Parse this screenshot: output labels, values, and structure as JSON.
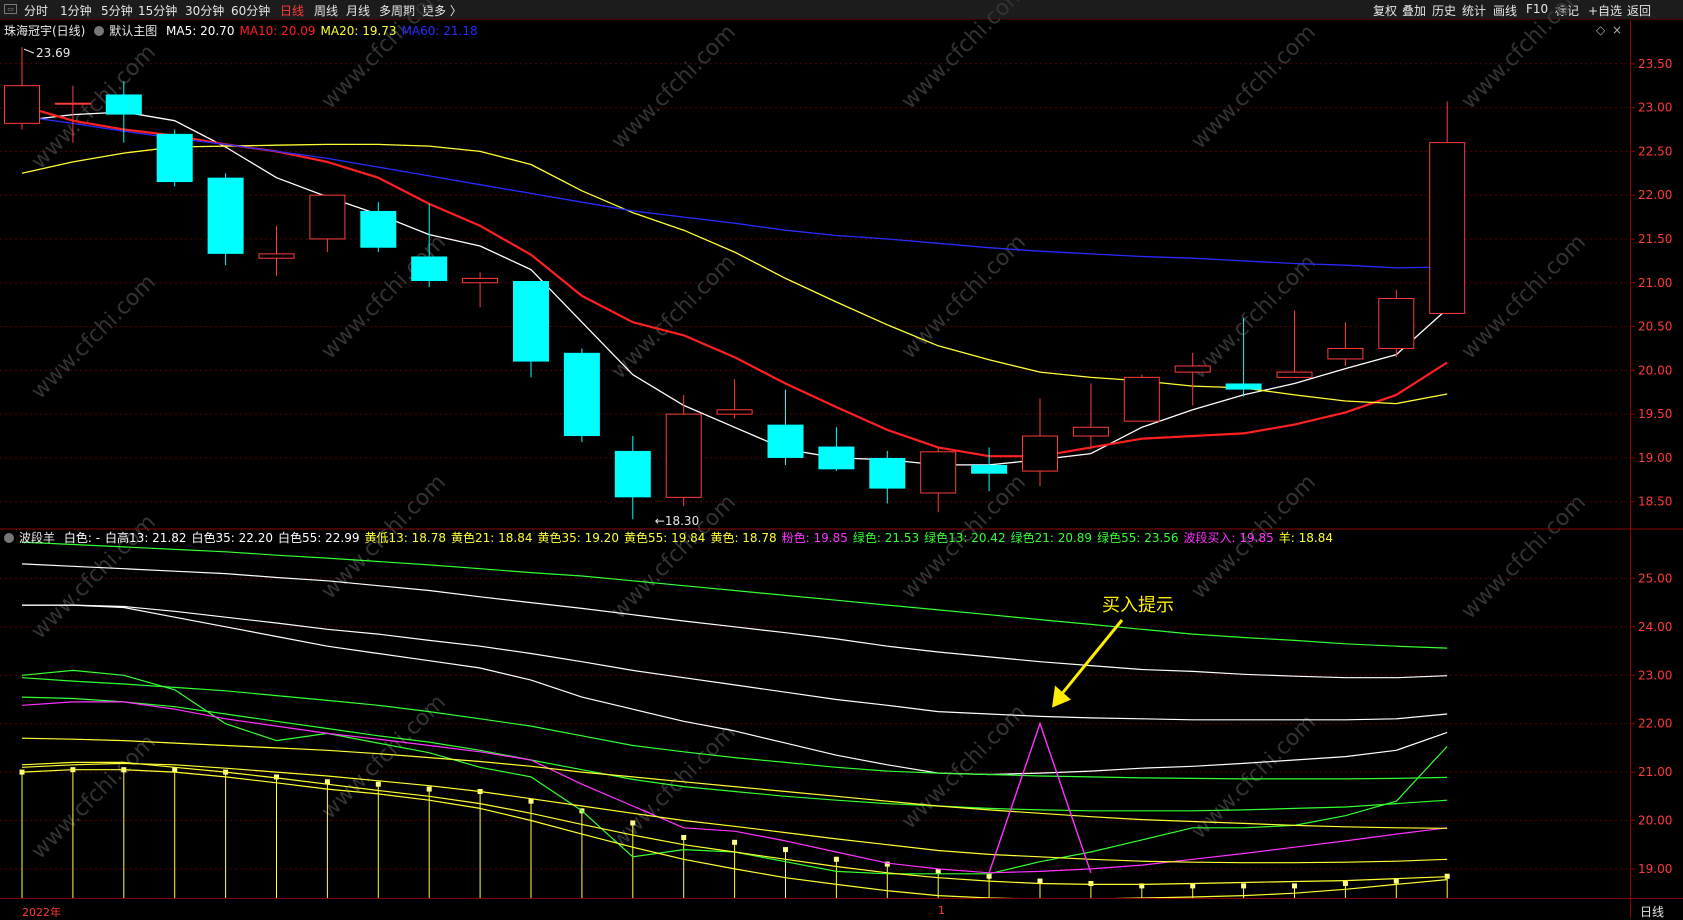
{
  "toolbar": {
    "left": [
      "分时",
      "1分钟",
      "5分钟",
      "15分钟",
      "30分钟",
      "60分钟",
      "日线",
      "周线",
      "月线",
      "多周期",
      "更多 〉"
    ],
    "active": "日线",
    "right": [
      "复权",
      "叠加",
      "历史",
      "统计",
      "画线",
      "F10",
      "标记",
      "+自选",
      "返回"
    ]
  },
  "main_legend": {
    "stock": "珠海冠宇(日线)",
    "indicator": "默认主图",
    "items": [
      {
        "label": "MA5: 20.70",
        "color": "#ffffff"
      },
      {
        "label": "MA10: 20.09",
        "color": "#ff2020"
      },
      {
        "label": "MA20: 19.73",
        "color": "#ffff33"
      },
      {
        "label": "MA60: 21.18",
        "color": "#2a2aff"
      }
    ]
  },
  "sub_legend": {
    "name": "波段羊",
    "items": [
      {
        "label": "白色: -",
        "color": "#ffffff"
      },
      {
        "label": "白高13: 21.82",
        "color": "#ffffff"
      },
      {
        "label": "白色35: 22.20",
        "color": "#ffffff"
      },
      {
        "label": "白色55: 22.99",
        "color": "#ffffff"
      },
      {
        "label": "黄低13: 18.78",
        "color": "#ffff33"
      },
      {
        "label": "黄色21: 18.84",
        "color": "#ffff33"
      },
      {
        "label": "黄色35: 19.20",
        "color": "#ffff33"
      },
      {
        "label": "黄色55: 19.84",
        "color": "#ffff33"
      },
      {
        "label": "黄色: 18.78",
        "color": "#ffff33"
      },
      {
        "label": "粉色: 19.85",
        "color": "#ff33ff"
      },
      {
        "label": "绿色: 21.53",
        "color": "#33ff33"
      },
      {
        "label": "绿色13: 20.42",
        "color": "#33ff33"
      },
      {
        "label": "绿色21: 20.89",
        "color": "#33ff33"
      },
      {
        "label": "绿色55: 23.56",
        "color": "#33ff33"
      },
      {
        "label": "波段买入: 19.85",
        "color": "#ff33ff"
      },
      {
        "label": "羊: 18.84",
        "color": "#ffff33"
      }
    ]
  },
  "annotation": "买入提示",
  "bottom": {
    "year_label": "2022年",
    "month_label": "1",
    "period_button": "日线"
  },
  "watermark": "www.cfchi.com",
  "chart_data": [
    {
      "type": "candlestick",
      "panel": "main",
      "ylim": [
        18.2,
        24.0
      ],
      "y_ticks": [
        18.5,
        19.0,
        19.5,
        20.0,
        20.5,
        21.0,
        21.5,
        22.0,
        22.5,
        23.0,
        23.5
      ],
      "max_label": "23.69",
      "min_label": "18.30",
      "candles": [
        {
          "o": 22.82,
          "h": 23.69,
          "l": 22.75,
          "c": 23.25
        },
        {
          "o": 23.05,
          "h": 23.25,
          "l": 22.6,
          "c": 23.05
        },
        {
          "o": 23.15,
          "h": 23.3,
          "l": 22.6,
          "c": 22.92
        },
        {
          "o": 22.7,
          "h": 22.75,
          "l": 22.1,
          "c": 22.15
        },
        {
          "o": 22.2,
          "h": 22.25,
          "l": 21.2,
          "c": 21.33
        },
        {
          "o": 21.28,
          "h": 21.65,
          "l": 21.08,
          "c": 21.33
        },
        {
          "o": 21.5,
          "h": 22.0,
          "l": 21.35,
          "c": 22.0
        },
        {
          "o": 21.82,
          "h": 21.92,
          "l": 21.35,
          "c": 21.4
        },
        {
          "o": 21.3,
          "h": 21.9,
          "l": 20.95,
          "c": 21.02
        },
        {
          "o": 21.0,
          "h": 21.12,
          "l": 20.72,
          "c": 21.05
        },
        {
          "o": 21.02,
          "h": 21.02,
          "l": 19.92,
          "c": 20.1
        },
        {
          "o": 20.2,
          "h": 20.25,
          "l": 19.18,
          "c": 19.25
        },
        {
          "o": 19.08,
          "h": 19.25,
          "l": 18.3,
          "c": 18.55
        },
        {
          "o": 18.55,
          "h": 19.72,
          "l": 18.45,
          "c": 19.5
        },
        {
          "o": 19.5,
          "h": 19.9,
          "l": 19.45,
          "c": 19.55
        },
        {
          "o": 19.38,
          "h": 19.78,
          "l": 18.92,
          "c": 19.0
        },
        {
          "o": 19.13,
          "h": 19.35,
          "l": 18.85,
          "c": 18.87
        },
        {
          "o": 19.0,
          "h": 19.08,
          "l": 18.48,
          "c": 18.65
        },
        {
          "o": 18.6,
          "h": 19.12,
          "l": 18.38,
          "c": 19.07
        },
        {
          "o": 18.92,
          "h": 19.12,
          "l": 18.62,
          "c": 18.82
        },
        {
          "o": 18.85,
          "h": 19.68,
          "l": 18.68,
          "c": 19.25
        },
        {
          "o": 19.25,
          "h": 19.85,
          "l": 19.1,
          "c": 19.35
        },
        {
          "o": 19.42,
          "h": 19.95,
          "l": 19.42,
          "c": 19.92
        },
        {
          "o": 19.98,
          "h": 20.2,
          "l": 19.6,
          "c": 20.05
        },
        {
          "o": 19.85,
          "h": 20.6,
          "l": 19.7,
          "c": 19.78
        },
        {
          "o": 19.92,
          "h": 20.68,
          "l": 19.92,
          "c": 19.98
        },
        {
          "o": 20.13,
          "h": 20.55,
          "l": 20.05,
          "c": 20.25
        },
        {
          "o": 20.25,
          "h": 20.92,
          "l": 20.15,
          "c": 20.82
        },
        {
          "o": 20.65,
          "h": 23.07,
          "l": 20.65,
          "c": 22.6
        }
      ],
      "series": [
        {
          "name": "MA5",
          "color": "#ffffff",
          "values": [
            22.85,
            22.92,
            22.95,
            22.85,
            22.55,
            22.2,
            21.98,
            21.78,
            21.55,
            21.42,
            21.15,
            20.55,
            19.95,
            19.6,
            19.35,
            19.1,
            19.0,
            18.98,
            18.92,
            18.92,
            18.98,
            19.05,
            19.35,
            19.55,
            19.72,
            19.85,
            20.02,
            20.18,
            20.7
          ]
        },
        {
          "name": "MA10",
          "color": "#ff2020",
          "values": [
            23.02,
            22.85,
            22.75,
            22.68,
            22.58,
            22.5,
            22.38,
            22.2,
            21.9,
            21.65,
            21.32,
            20.85,
            20.55,
            20.4,
            20.15,
            19.85,
            19.58,
            19.32,
            19.12,
            19.02,
            19.02,
            19.12,
            19.22,
            19.25,
            19.28,
            19.38,
            19.52,
            19.72,
            20.09
          ]
        },
        {
          "name": "MA20",
          "color": "#ffff33",
          "values": [
            22.25,
            22.38,
            22.48,
            22.55,
            22.56,
            22.57,
            22.58,
            22.58,
            22.56,
            22.5,
            22.35,
            22.05,
            21.8,
            21.6,
            21.35,
            21.05,
            20.78,
            20.52,
            20.28,
            20.12,
            19.98,
            19.92,
            19.88,
            19.82,
            19.8,
            19.72,
            19.65,
            19.62,
            19.73
          ]
        },
        {
          "name": "MA60",
          "color": "#2a2aff",
          "values": [
            22.9,
            22.82,
            22.73,
            22.65,
            22.58,
            22.5,
            22.42,
            22.32,
            22.22,
            22.12,
            22.02,
            21.92,
            21.82,
            21.75,
            21.68,
            21.6,
            21.54,
            21.5,
            21.45,
            21.4,
            21.36,
            21.33,
            21.3,
            21.28,
            21.25,
            21.22,
            21.2,
            21.17,
            21.18
          ]
        }
      ]
    },
    {
      "type": "line",
      "panel": "sub",
      "ylim": [
        18.4,
        26.0
      ],
      "y_ticks": [
        19.0,
        20.0,
        21.0,
        22.0,
        23.0,
        24.0,
        25.0
      ],
      "yellow_bar_values": [
        21.0,
        21.05,
        21.05,
        21.05,
        21.0,
        20.9,
        20.8,
        20.75,
        20.65,
        20.6,
        20.4,
        20.2,
        19.95,
        19.65,
        19.55,
        19.4,
        19.2,
        19.1,
        18.95,
        18.85,
        18.75,
        18.7,
        18.65,
        18.65,
        18.65,
        18.65,
        18.7,
        18.75,
        18.85
      ],
      "series": [
        {
          "name": "绿色55",
          "color": "#33ff33",
          "values": [
            25.75,
            25.7,
            25.65,
            25.6,
            25.55,
            25.48,
            25.42,
            25.35,
            25.28,
            25.2,
            25.12,
            25.05,
            24.95,
            24.85,
            24.75,
            24.65,
            24.55,
            24.45,
            24.35,
            24.25,
            24.15,
            24.05,
            23.95,
            23.85,
            23.78,
            23.72,
            23.65,
            23.6,
            23.56
          ]
        },
        {
          "name": "白色55",
          "color": "#ffffff",
          "values": [
            25.3,
            25.25,
            25.2,
            25.15,
            25.1,
            25.02,
            24.95,
            24.85,
            24.75,
            24.62,
            24.5,
            24.38,
            24.25,
            24.12,
            24.0,
            23.88,
            23.75,
            23.6,
            23.48,
            23.38,
            23.28,
            23.2,
            23.12,
            23.08,
            23.02,
            22.98,
            22.95,
            22.95,
            22.99
          ]
        },
        {
          "name": "白色35",
          "color": "#ffffff",
          "values": [
            24.45,
            24.45,
            24.42,
            24.32,
            24.2,
            24.08,
            23.95,
            23.85,
            23.72,
            23.6,
            23.45,
            23.28,
            23.1,
            22.95,
            22.8,
            22.65,
            22.5,
            22.38,
            22.25,
            22.2,
            22.15,
            22.12,
            22.1,
            22.08,
            22.08,
            22.08,
            22.08,
            22.1,
            22.2
          ]
        },
        {
          "name": "白高13",
          "color": "#ffffff",
          "values": [
            24.45,
            24.45,
            24.4,
            24.2,
            24.0,
            23.8,
            23.6,
            23.45,
            23.3,
            23.15,
            22.9,
            22.55,
            22.3,
            22.05,
            21.85,
            21.6,
            21.35,
            21.15,
            20.98,
            20.95,
            20.98,
            21.02,
            21.08,
            21.12,
            21.18,
            21.25,
            21.32,
            21.45,
            21.82
          ]
        },
        {
          "name": "绿色21",
          "color": "#33ff33",
          "values": [
            22.95,
            22.88,
            22.82,
            22.75,
            22.68,
            22.58,
            22.48,
            22.38,
            22.25,
            22.1,
            21.95,
            21.75,
            21.55,
            21.42,
            21.3,
            21.2,
            21.1,
            21.02,
            20.98,
            20.95,
            20.92,
            20.9,
            20.88,
            20.87,
            20.86,
            20.86,
            20.86,
            20.87,
            20.89
          ]
        },
        {
          "name": "绿色13",
          "color": "#33ff33",
          "values": [
            22.55,
            22.52,
            22.45,
            22.35,
            22.2,
            22.05,
            21.9,
            21.75,
            21.62,
            21.45,
            21.25,
            21.05,
            20.85,
            20.7,
            20.6,
            20.5,
            20.42,
            20.35,
            20.3,
            20.25,
            20.22,
            20.2,
            20.2,
            20.2,
            20.22,
            20.25,
            20.28,
            20.35,
            20.42
          ]
        },
        {
          "name": "绿色",
          "color": "#33ff33",
          "values": [
            23.0,
            23.1,
            23.0,
            22.7,
            22.0,
            21.65,
            21.8,
            21.6,
            21.4,
            21.1,
            20.9,
            20.2,
            19.25,
            19.4,
            19.35,
            19.15,
            18.95,
            18.9,
            18.9,
            18.9,
            19.15,
            19.35,
            19.6,
            19.85,
            19.85,
            19.9,
            20.1,
            20.4,
            21.53
          ]
        },
        {
          "name": "粉色",
          "color": "#ff33ff",
          "values": [
            22.38,
            22.45,
            22.45,
            22.3,
            22.1,
            21.95,
            21.8,
            21.68,
            21.55,
            21.42,
            21.25,
            20.75,
            20.3,
            19.85,
            19.78,
            19.58,
            19.35,
            19.12,
            19.0,
            18.92,
            18.95,
            19.0,
            19.08,
            19.2,
            19.32,
            19.45,
            19.58,
            19.72,
            19.85
          ]
        },
        {
          "name": "黄色55",
          "color": "#ffff33",
          "values": [
            21.7,
            21.68,
            21.65,
            21.6,
            21.55,
            21.5,
            21.45,
            21.38,
            21.3,
            21.22,
            21.12,
            21.0,
            20.9,
            20.8,
            20.7,
            20.6,
            20.5,
            20.4,
            20.3,
            20.22,
            20.15,
            20.08,
            20.02,
            19.98,
            19.94,
            19.9,
            19.87,
            19.85,
            19.84
          ]
        },
        {
          "name": "黄色35",
          "color": "#ffff33",
          "values": [
            21.1,
            21.15,
            21.18,
            21.15,
            21.08,
            21.0,
            20.92,
            20.82,
            20.72,
            20.6,
            20.45,
            20.3,
            20.15,
            20.0,
            19.88,
            19.75,
            19.62,
            19.5,
            19.38,
            19.3,
            19.25,
            19.2,
            19.16,
            19.14,
            19.13,
            19.13,
            19.14,
            19.16,
            19.2
          ]
        },
        {
          "name": "黄色21",
          "color": "#ffff33",
          "values": [
            21.15,
            21.2,
            21.2,
            21.1,
            21.0,
            20.88,
            20.75,
            20.62,
            20.5,
            20.35,
            20.15,
            19.92,
            19.7,
            19.5,
            19.35,
            19.2,
            19.05,
            18.92,
            18.82,
            18.75,
            18.7,
            18.68,
            18.68,
            18.7,
            18.72,
            18.74,
            18.76,
            18.8,
            18.84
          ]
        },
        {
          "name": "黄低13",
          "color": "#ffff33",
          "values": [
            21.0,
            21.05,
            21.05,
            21.0,
            20.9,
            20.78,
            20.65,
            20.55,
            20.42,
            20.25,
            20.0,
            19.72,
            19.45,
            19.2,
            19.0,
            18.82,
            18.68,
            18.55,
            18.45,
            18.4,
            18.38,
            18.38,
            18.4,
            18.42,
            18.45,
            18.5,
            18.58,
            18.68,
            18.78
          ]
        },
        {
          "name": "波段买入",
          "color": "#ff33ff",
          "spike": {
            "from": 19,
            "peak": 20,
            "to": 21,
            "peak_value": 22.0,
            "base": 18.92
          }
        }
      ]
    }
  ]
}
